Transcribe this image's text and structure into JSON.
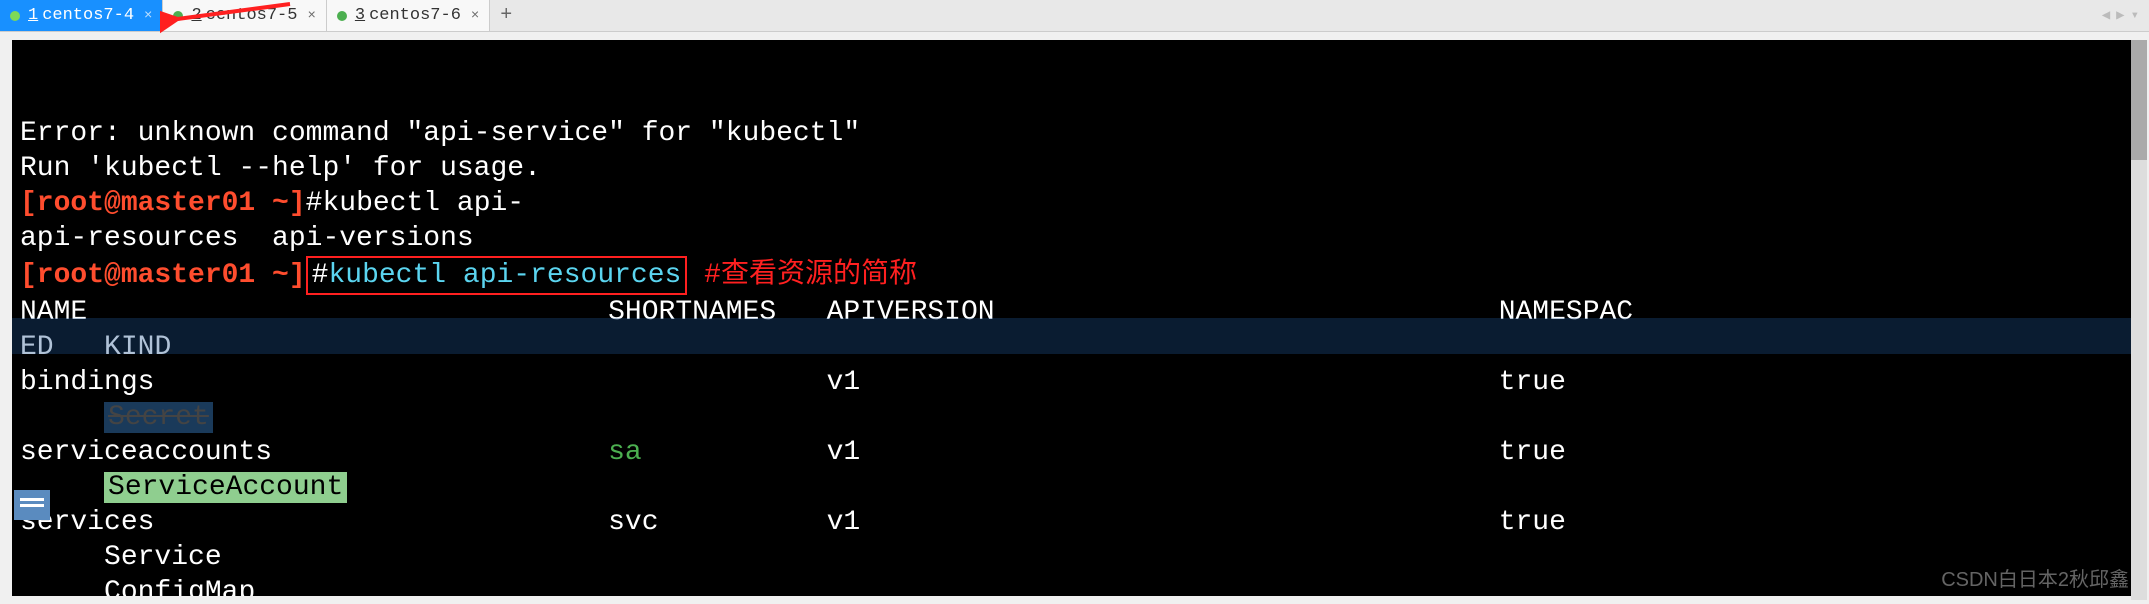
{
  "tabs": [
    {
      "num": "1",
      "label": "centos7-4",
      "active": true
    },
    {
      "num": "2",
      "label": "centos7-5",
      "active": false
    },
    {
      "num": "3",
      "label": "centos7-6",
      "active": false
    }
  ],
  "tab_add": "+",
  "nav": {
    "left": "◀",
    "right": "▶",
    "down": "▾"
  },
  "terminal": {
    "err1": "Error: unknown command \"api-service\" for \"kubectl\"",
    "err2": "Run 'kubectl --help' for usage.",
    "prompt_user": "[root@master01 ~]",
    "prompt_hash": "#",
    "cmd_partial": "kubectl api-",
    "completions": "api-resources  api-versions",
    "cmd_full": "kubectl api-resources",
    "annotation": "#查看资源的简称",
    "header": {
      "name": "NAME",
      "shortnames": "SHORTNAMES",
      "apiversion": "APIVERSION",
      "namespaced": "NAMESPAC",
      "ed": "ED",
      "kind": "KIND"
    },
    "rows": [
      {
        "name": "bindings",
        "short": "",
        "api": "v1",
        "ns": "true",
        "kind": ""
      },
      {
        "name": "serviceaccounts",
        "short": "sa",
        "api": "v1",
        "ns": "true",
        "kind": "ServiceAccount"
      },
      {
        "name": "services",
        "short": "svc",
        "api": "v1",
        "ns": "true",
        "kind": "Service"
      }
    ],
    "secret_cut": "Secret",
    "configmap_cut": "ConfigMap"
  },
  "watermark": "CSDN白日本2秋邱鑫"
}
